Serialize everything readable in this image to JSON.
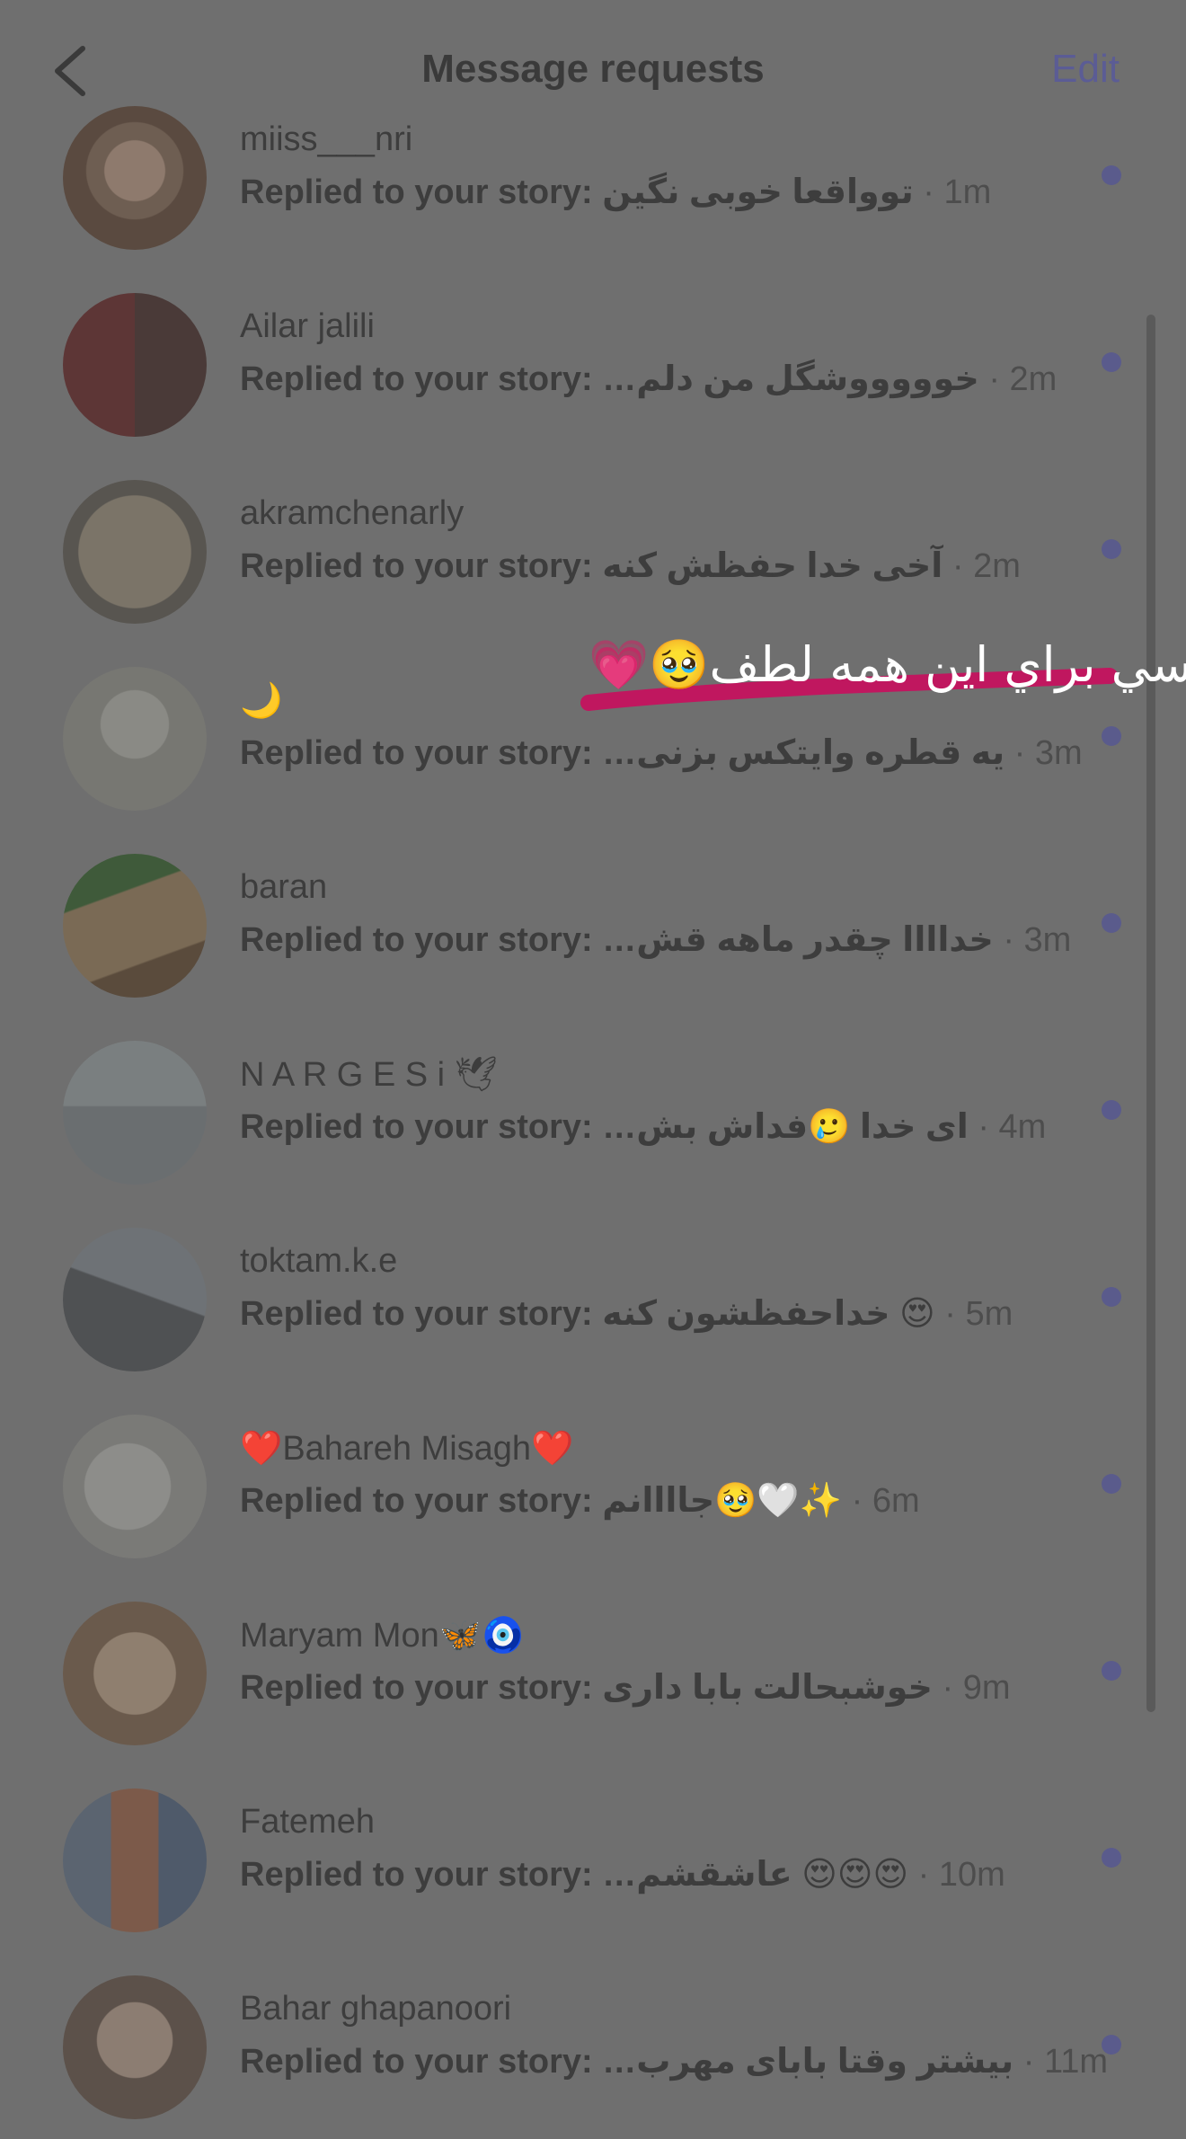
{
  "header": {
    "title": "Message requests",
    "edit_label": "Edit"
  },
  "colors": {
    "background": "#6f6f6f",
    "edit_accent": "#5b5c95",
    "unread_dot": "#5a5b8c",
    "overlay_stroke": "#c0175f"
  },
  "overlay": {
    "text": "مرسي براي اين همه لطف🥹💗"
  },
  "requests": [
    {
      "username": "miiss___nri",
      "prefix": "Replied to your story:",
      "message": "توواقعا خوبی نگین",
      "time": "1m"
    },
    {
      "username": "Ailar jalili",
      "prefix": "Replied to your story:",
      "message": "…خوووووشگل من دلم",
      "time": "2m"
    },
    {
      "username": "akramchenarly",
      "prefix": "Replied to your story:",
      "message": "آخی خدا حفظش کنه",
      "time": "2m"
    },
    {
      "username": "🌙",
      "prefix": "Replied to your story:",
      "message": "…یه قطره وایتکس بزنی",
      "time": "3m"
    },
    {
      "username": "baran",
      "prefix": "Replied to your story:",
      "message": "…خداااا چقدر ماهه قش",
      "time": "3m"
    },
    {
      "username": "N A R G E S i 🕊",
      "prefix": "Replied to your story:",
      "message": "…ای خدا 🥲فداش بش",
      "time": "4m"
    },
    {
      "username": "toktam.k.e",
      "prefix": "Replied to your story:",
      "message": "خداحفظشون کنه 😍",
      "time": "5m"
    },
    {
      "username": "❤️Bahareh Misagh❤️",
      "prefix": "Replied to your story:",
      "message": "جاااانم🥹🤍✨",
      "time": "6m"
    },
    {
      "username": "Maryam Mon🦋🧿",
      "prefix": "Replied to your story:",
      "message": "خوشبحالت بابا داری",
      "time": "9m"
    },
    {
      "username": "Fatemeh",
      "prefix": "Replied to your story:",
      "message": "…عاشقشم 😍😍😍",
      "time": "10m"
    },
    {
      "username": "Bahar ghapanoori",
      "prefix": "Replied to your story:",
      "message": "…بیشتر وقتا بابای مهرب",
      "time": "11m"
    }
  ]
}
